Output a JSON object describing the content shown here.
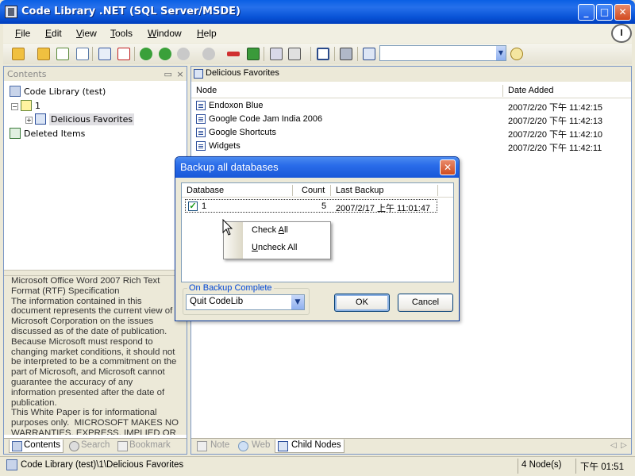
{
  "window": {
    "title": "Code Library .NET (SQL Server/MSDE)"
  },
  "menu": [
    {
      "key": "F",
      "rest": "ile"
    },
    {
      "key": "E",
      "rest": "dit"
    },
    {
      "key": "V",
      "rest": "iew"
    },
    {
      "key": "T",
      "rest": "ools"
    },
    {
      "key": "W",
      "rest": "indow"
    },
    {
      "key": "H",
      "rest": "elp"
    }
  ],
  "toolbar": {
    "combo_value": "",
    "combo_arrow": "▼"
  },
  "left_panel": {
    "header": "Contents",
    "pin": " ▭ ×",
    "tree": [
      {
        "label": "Code Library (test)"
      },
      {
        "label": "1"
      },
      {
        "label": "Delicious Favorites"
      },
      {
        "label": "Deleted Items"
      }
    ],
    "description": "Microsoft Office Word 2007 Rich Text Format (RTF) Specification\nThe information contained in this document represents the current view of Microsoft Corporation on the issues discussed as of the date of publication.  Because Microsoft must respond to changing market conditions, it should not be interpreted to be a commitment on the part of Microsoft, and Microsoft cannot guarantee the accuracy of any information presented after the date of publication.\nThis White Paper is for informational purposes only.  MICROSOFT MAKES NO WARRANTIES, EXPRESS, IMPLIED OR STATUTORY, AS TO THE INFORMATION IN",
    "tabs": [
      "Contents",
      "Search",
      "Bookmark"
    ]
  },
  "right_panel": {
    "breadcrumb": "Delicious Favorites",
    "columns": [
      "Node",
      "Date Added"
    ],
    "rows": [
      {
        "name": "Endoxon Blue",
        "date": "2007/2/20 下午 11:42:15"
      },
      {
        "name": "Google Code Jam India 2006",
        "date": "2007/2/20 下午 11:42:13"
      },
      {
        "name": "Google Shortcuts",
        "date": "2007/2/20 下午 11:42:10"
      },
      {
        "name": "Widgets",
        "date": "2007/2/20 下午 11:42:11"
      }
    ],
    "tabs": [
      "Note",
      "Web",
      "Child Nodes"
    ]
  },
  "dialog": {
    "title": "Backup all databases",
    "columns": [
      "Database",
      "Count",
      "Last Backup"
    ],
    "row": {
      "checked": "✓",
      "database": "1",
      "count": "5",
      "last_backup": "2007/2/17 上午 11:01:47"
    },
    "context_menu": [
      {
        "pre": "Check ",
        "key": "A",
        "post": "ll"
      },
      {
        "pre": "",
        "key": "U",
        "post": "ncheck All"
      }
    ],
    "group_label": "On Backup Complete",
    "select_value": "Quit CodeLib",
    "ok_label": "OK",
    "cancel_label": "Cancel"
  },
  "status": {
    "path": "Code Library (test)\\1\\Delicious Favorites",
    "count": "4 Node(s)",
    "time": "下午 01:51"
  },
  "colors": {
    "titlebar": "#0a55d8",
    "accent": "#0046d5",
    "workspace": "#ece9d8"
  }
}
